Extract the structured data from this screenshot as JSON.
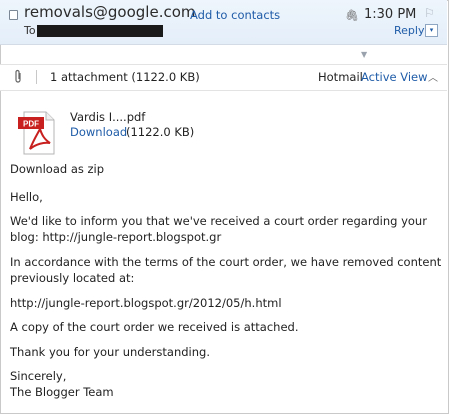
{
  "header": {
    "sender": "removals@google.com",
    "add_contact": "Add to contacts",
    "to_label": "To",
    "time": "1:30 PM",
    "reply": "Reply",
    "reply_dropdown_glyph": "▾"
  },
  "attachments_bar": {
    "count": "1 attachment (1122.0 KB)",
    "service": "Hotmail",
    "active_view": "Active View"
  },
  "attachment": {
    "filename": "Vardis I....pdf",
    "download": "Download",
    "size": "(1122.0 KB)",
    "icon_label": "PDF"
  },
  "download_zip": "Download as zip",
  "body": {
    "greeting": "Hello,",
    "p1_line1": "We'd like to inform you that we've received a court order regarding your",
    "p1_line2": "blog: http://jungle-report.blogspot.gr",
    "p2_line1": "In accordance with the terms of the court order, we have removed content",
    "p2_line2": "previously located at:",
    "url": "http://jungle-report.blogspot.gr/2012/05/h.html",
    "p3": "A copy of the court order we received is attached.",
    "p4": "Thank you for your understanding.",
    "closing": "Sincerely,",
    "signature": "The Blogger Team"
  },
  "colors": {
    "link": "#1f5ca8",
    "header_bg": "#e8f1fb",
    "pdf_red": "#c8201f"
  },
  "icons": [
    "envelope-icon",
    "paperclip-icon",
    "flag-icon",
    "chevron-down-icon",
    "chevron-up-icon",
    "pdf-icon"
  ]
}
